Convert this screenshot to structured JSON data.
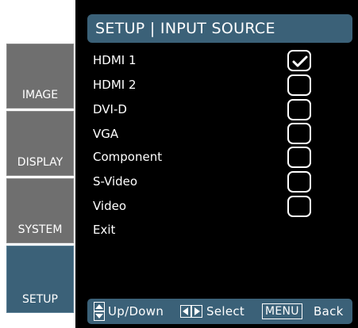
{
  "title": "SETUP | INPUT SOURCE",
  "tabs": [
    {
      "label": "IMAGE"
    },
    {
      "label": "DISPLAY"
    },
    {
      "label": "SYSTEM"
    },
    {
      "label": "SETUP",
      "active": true
    }
  ],
  "sources": [
    {
      "label": "HDMI 1",
      "checked": true
    },
    {
      "label": "HDMI 2",
      "checked": false
    },
    {
      "label": "DVI-D",
      "checked": false
    },
    {
      "label": "VGA",
      "checked": false
    },
    {
      "label": "Component",
      "checked": false
    },
    {
      "label": "S-Video",
      "checked": false
    },
    {
      "label": "Video",
      "checked": false
    }
  ],
  "exit_label": "Exit",
  "footer": {
    "updown_label": "Up/Down",
    "select_label": "Select",
    "menu_key": "MENU",
    "back_label": "Back"
  },
  "colors": {
    "accent": "#3b6178",
    "tab_inactive": "#6f6f6f",
    "background": "#000000"
  }
}
